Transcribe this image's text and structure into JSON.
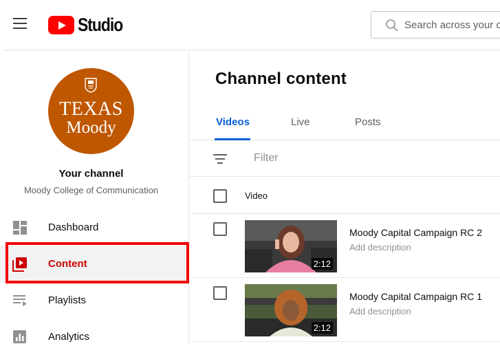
{
  "header": {
    "app_name": "Studio",
    "search_placeholder": "Search across your channel"
  },
  "sidebar": {
    "avatar_line1": "TEXAS",
    "avatar_line2": "Moody",
    "channel_label": "Your channel",
    "channel_name": "Moody College of Communication",
    "items": [
      {
        "label": "Dashboard",
        "icon": "dashboard-icon",
        "active": false
      },
      {
        "label": "Content",
        "icon": "content-icon",
        "active": true
      },
      {
        "label": "Playlists",
        "icon": "playlists-icon",
        "active": false
      },
      {
        "label": "Analytics",
        "icon": "analytics-icon",
        "active": false
      }
    ]
  },
  "main": {
    "title": "Channel content",
    "tabs": [
      {
        "label": "Videos",
        "active": true
      },
      {
        "label": "Live",
        "active": false
      },
      {
        "label": "Posts",
        "active": false
      }
    ],
    "filter_placeholder": "Filter",
    "column_header": "Video",
    "videos": [
      {
        "title": "Moody Capital Campaign RC 2",
        "description": "Add description",
        "duration": "2:12"
      },
      {
        "title": "Moody Capital Campaign RC 1",
        "description": "Add description",
        "duration": "2:12"
      }
    ]
  },
  "colors": {
    "brand_red": "#ff0000",
    "active_red": "#cc0000",
    "tab_blue": "#065fd4",
    "avatar_orange": "#bf5700",
    "highlight": "#f20000"
  }
}
